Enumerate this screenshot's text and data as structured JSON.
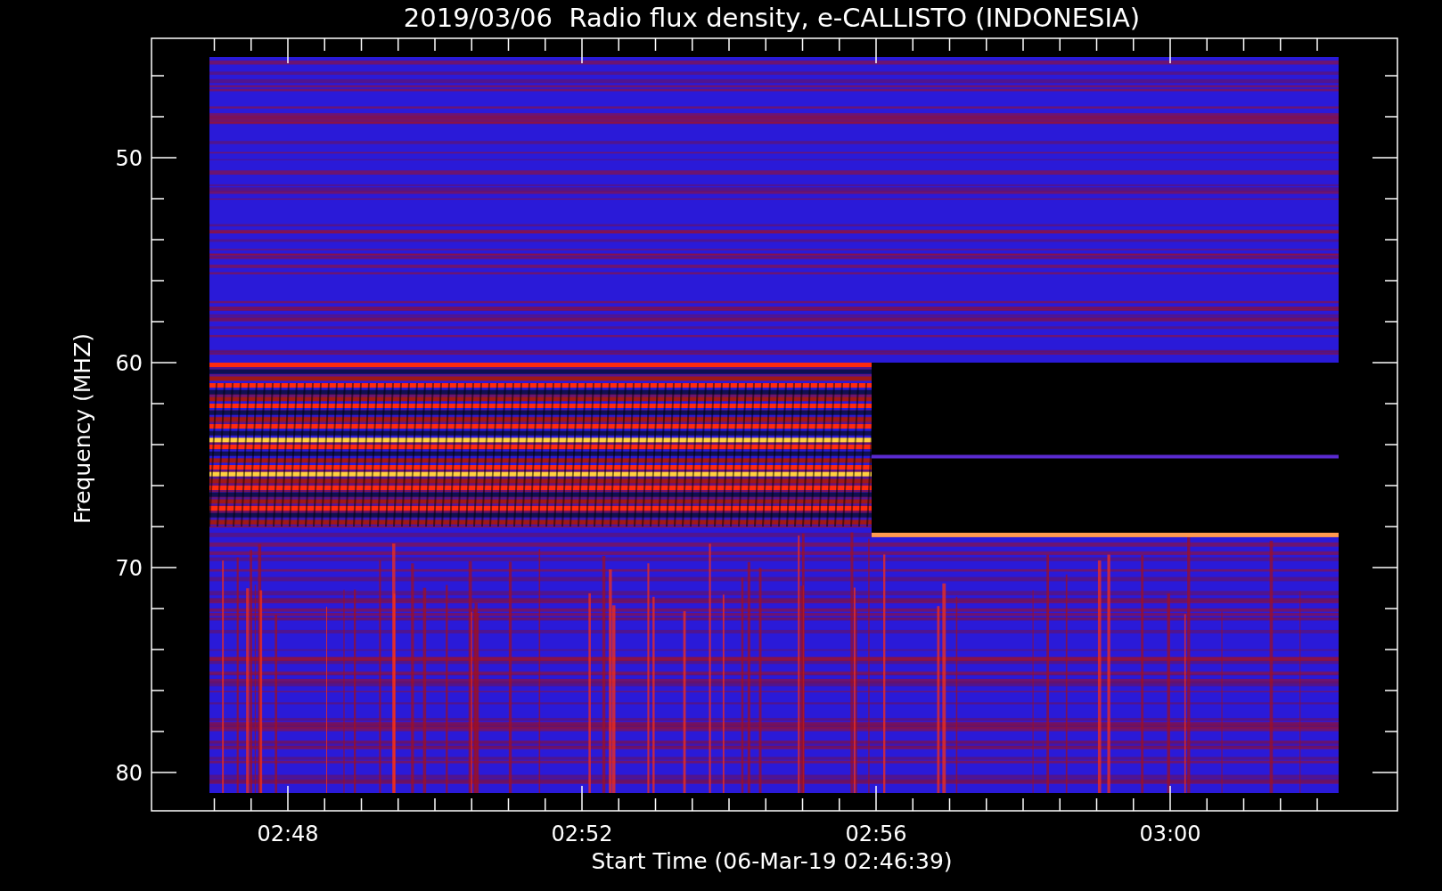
{
  "title": "2019/03/06  Radio flux density, e-CALLISTO (INDONESIA)",
  "ylabel": "Frequency (MHZ)",
  "xlabel": "Start Time (06-Mar-19 02:46:39)",
  "yticks": [
    "50",
    "60",
    "70",
    "80"
  ],
  "xticks": [
    "02:48",
    "02:52",
    "02:56",
    "03:00"
  ]
}
